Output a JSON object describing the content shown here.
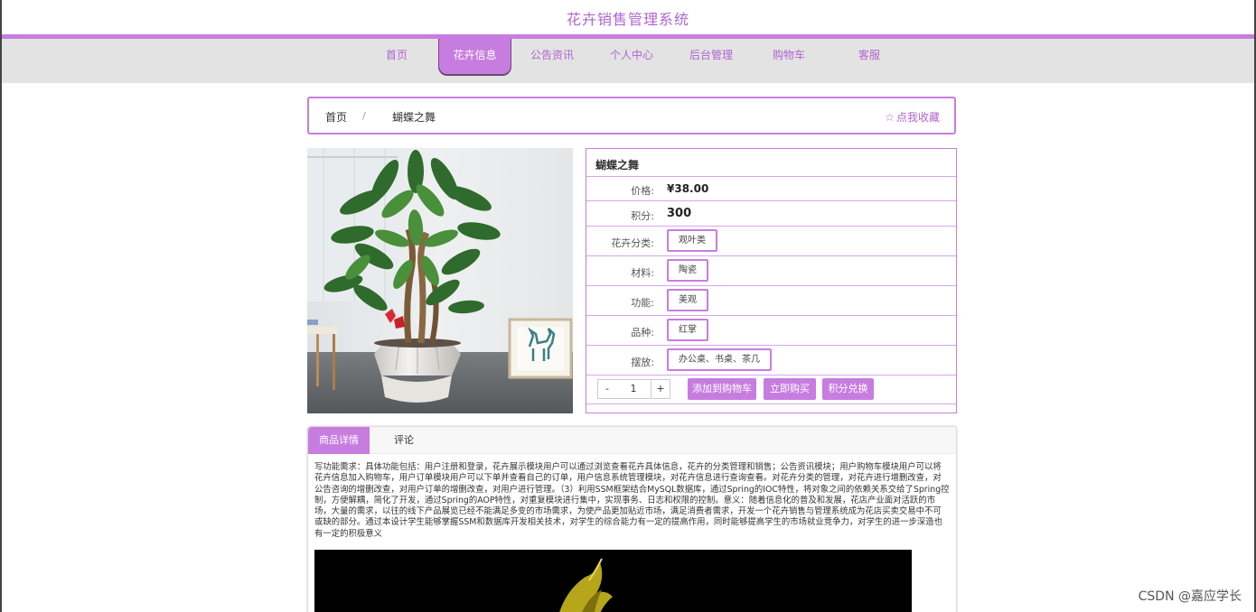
{
  "header": {
    "title": "花卉销售管理系统"
  },
  "nav": {
    "items": [
      {
        "label": "首页"
      },
      {
        "label": "花卉信息",
        "active": true
      },
      {
        "label": "公告资讯"
      },
      {
        "label": "个人中心"
      },
      {
        "label": "后台管理"
      },
      {
        "label": "购物车"
      },
      {
        "label": "客服"
      }
    ]
  },
  "breadcrumb": {
    "home": "首页",
    "separator": "/",
    "current": "蝴蝶之舞",
    "favorite": "点我收藏"
  },
  "product": {
    "name": "蝴蝶之舞",
    "price_label": "价格:",
    "price": "¥38.00",
    "points_label": "积分:",
    "points": "300",
    "category_label": "花卉分类:",
    "category": "观叶类",
    "material_label": "材料:",
    "material": "陶瓷",
    "function_label": "功能:",
    "function": "美观",
    "variety_label": "品种:",
    "variety": "红掌",
    "placement_label": "摆放:",
    "placement": "办公桌、书桌、茶几",
    "quantity": "1",
    "minus": "-",
    "plus": "+",
    "add_to_cart": "添加到购物车",
    "buy_now": "立即购买",
    "points_exchange": "积分兑换"
  },
  "tabs": {
    "details": "商品详情",
    "comments": "评论"
  },
  "description": "写功能需求：具体功能包括：用户注册和登录，花卉展示模块用户可以通过浏览查看花卉具体信息，花卉的分类管理和销售；公告资讯模块；用户购物车模块用户可以将花卉信息加入购物车，用户订单模块用户可以下单并查看自己的订单，用户信息系统管理模块，对花卉信息进行查询查看。对花卉分类的管理，对花卉进行增删改查，对公告咨询的增删改查，对用户订单的增删改查，对用户进行管理。（3）利用SSM框架结合MySQL数据库，通过Spring的IOC特性，将对象之间的依赖关系交给了Spring控制，方便解耦，简化了开发，通过Spring的AOP特性，对重复模块进行集中，实现事务、日志和权限的控制。意义：随着信息化的普及和发展，花店产业面对活跃的市场，大量的需求，以往的线下产品展览已经不能满足多变的市场需求，为使产品更加贴近市场，满足消费者需求，开发一个花卉销售与管理系统成为花店买卖交易中不可或缺的部分。通过本设计学生能够掌握SSM和数据库开发相关技术，对学生的综合能力有一定的提高作用，同时能够提高学生的市场就业竞争力，对学生的进一步深造也有一定的积极意义",
  "watermark": "CSDN @嘉应学长",
  "colors": {
    "accent": "#c77de0",
    "accent_text": "#b065d0",
    "nav_bg": "#e3e3e3"
  }
}
